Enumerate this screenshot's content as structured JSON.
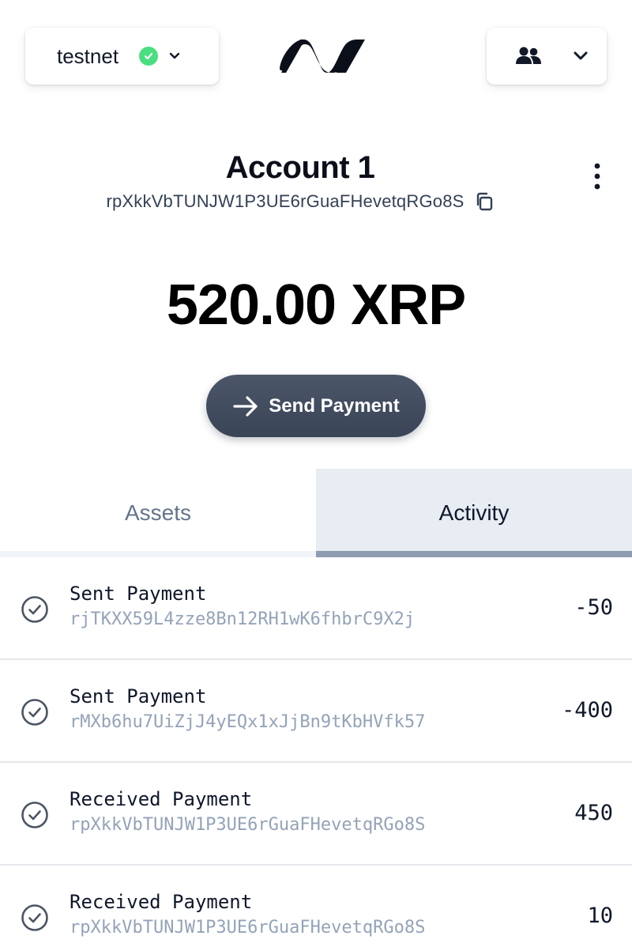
{
  "header": {
    "network": {
      "name": "testnet",
      "status": "connected",
      "status_icon": "check-circle-icon",
      "chevron_icon": "chevron-down-icon"
    },
    "logo_icon": "wallet-logo-icon",
    "accounts_button": {
      "icon": "users-icon",
      "chevron_icon": "chevron-down-icon"
    }
  },
  "account": {
    "name": "Account 1",
    "address": "rpXkkVbTUNJW1P3UE6rGuaFHevetqRGo8S",
    "copy_icon": "copy-icon",
    "menu_icon": "kebab-menu-icon"
  },
  "balance": {
    "text": "520.00 XRP"
  },
  "send_button": {
    "label": "Send Payment",
    "icon": "arrow-right-icon"
  },
  "tabs": [
    {
      "label": "Assets",
      "active": false
    },
    {
      "label": "Activity",
      "active": true
    }
  ],
  "activity": [
    {
      "title": "Sent Payment",
      "address": "rjTKXX59L4zze8Bn12RH1wK6fhbrC9X2j",
      "amount": "-50",
      "icon": "check-circle-icon"
    },
    {
      "title": "Sent Payment",
      "address": "rMXb6hu7UiZjJ4yEQx1xJjBn9tKbHVfk57",
      "amount": "-400",
      "icon": "check-circle-icon"
    },
    {
      "title": "Received Payment",
      "address": "rpXkkVbTUNJW1P3UE6rGuaFHevetqRGo8S",
      "amount": "450",
      "icon": "check-circle-icon"
    },
    {
      "title": "Received Payment",
      "address": "rpXkkVbTUNJW1P3UE6rGuaFHevetqRGo8S",
      "amount": "10",
      "icon": "check-circle-icon"
    }
  ],
  "colors": {
    "status_green": "#4ade80",
    "button_dark": "#3f495c",
    "tab_active_bg": "#e8ecf3",
    "tab_active_underline": "#8e9ab0",
    "muted_text": "#94a3b8"
  }
}
